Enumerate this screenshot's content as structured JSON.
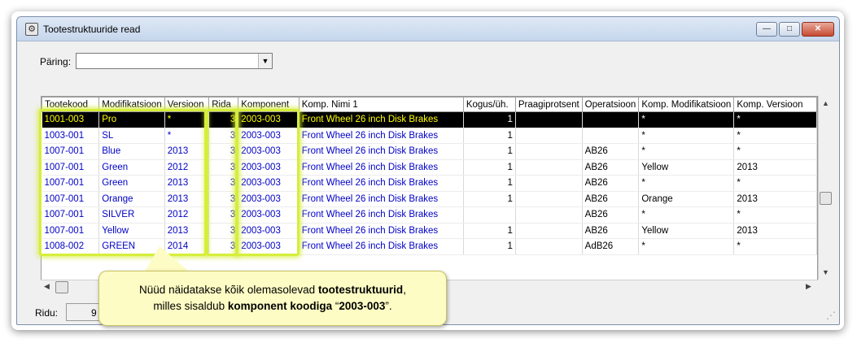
{
  "window": {
    "title": "Tootestruktuuride read",
    "controls": {
      "minimize": "—",
      "maximize": "□",
      "close": "✕"
    }
  },
  "query": {
    "label": "Päring:",
    "value": ""
  },
  "table": {
    "columns": [
      "Tootekood",
      "Modifikatsioon",
      "Versioon",
      "Rida",
      "Komponent",
      "Komp. Nimi 1",
      "Kogus/üh.",
      "Praagiprotsent",
      "Operatsioon",
      "Komp. Modifikatsioon",
      "Komp. Versioon"
    ],
    "rows": [
      [
        "1001-003",
        "Pro",
        "*",
        "3",
        "2003-003",
        "Front Wheel 26 inch Disk Brakes",
        "1",
        "",
        "",
        "*",
        "*"
      ],
      [
        "1003-001",
        "SL",
        "*",
        "3",
        "2003-003",
        "Front Wheel 26 inch Disk Brakes",
        "1",
        "",
        "",
        "*",
        "*"
      ],
      [
        "1007-001",
        "Blue",
        "2013",
        "3",
        "2003-003",
        "Front Wheel 26 inch Disk Brakes",
        "1",
        "",
        "AB26",
        "*",
        "*"
      ],
      [
        "1007-001",
        "Green",
        "2012",
        "3",
        "2003-003",
        "Front Wheel 26 inch Disk Brakes",
        "1",
        "",
        "AB26",
        "Yellow",
        "2013"
      ],
      [
        "1007-001",
        "Green",
        "2013",
        "3",
        "2003-003",
        "Front Wheel 26 inch Disk Brakes",
        "1",
        "",
        "AB26",
        "*",
        "*"
      ],
      [
        "1007-001",
        "Orange",
        "2013",
        "3",
        "2003-003",
        "Front Wheel 26 inch Disk Brakes",
        "1",
        "",
        "AB26",
        "Orange",
        "2013"
      ],
      [
        "1007-001",
        "SILVER",
        "2012",
        "3",
        "2003-003",
        "Front Wheel 26 inch Disk Brakes",
        "",
        "",
        "AB26",
        "*",
        "*"
      ],
      [
        "1007-001",
        "Yellow",
        "2013",
        "3",
        "2003-003",
        "Front Wheel 26 inch Disk Brakes",
        "1",
        "",
        "AB26",
        "Yellow",
        "2013"
      ],
      [
        "1008-002",
        "GREEN",
        "2014",
        "3",
        "2003-003",
        "Front Wheel 26 inch Disk Brakes",
        "1",
        "",
        "AdB26",
        "*",
        "*"
      ]
    ],
    "selected_row": 0
  },
  "status": {
    "label": "Ridu:",
    "count": "9"
  },
  "callout": {
    "line1_pre": "Nüüd näidatakse kõik olemasolevad ",
    "line1_bold": "tootestruktuurid",
    "line1_post": ",",
    "line2_pre": "milles sisaldub ",
    "line2_bold": "komponent koodiga",
    "line2_mid": " “",
    "line2_code": "2003-003",
    "line2_post": "”."
  },
  "colors": {
    "link_text": "#0000c8",
    "selected_bg": "#000000",
    "selected_text": "#ffff00",
    "highlight": "#d6ee3b",
    "callout_bg": "#fdfcc4"
  }
}
